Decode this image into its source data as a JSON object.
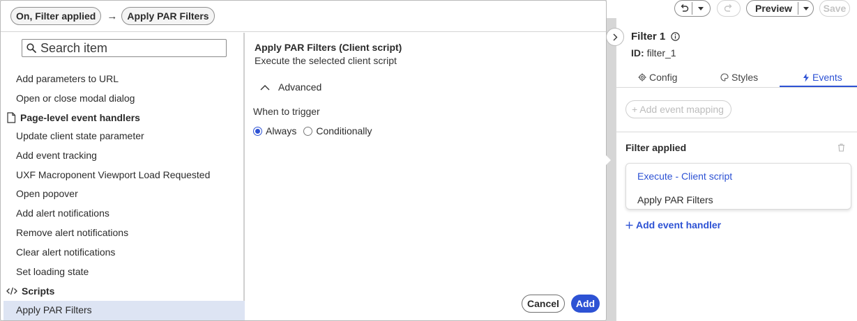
{
  "modal": {
    "breadcrumb": {
      "event": "On, Filter applied",
      "arrow": "→",
      "action": "Apply PAR Filters"
    },
    "search": {
      "placeholder": "Search item"
    },
    "menu_items": [
      "Add parameters to URL",
      "Open or close modal dialog"
    ],
    "group_page_level": "Page-level event handlers",
    "page_level_items": [
      "Update client state parameter",
      "Add event tracking",
      "UXF Macroponent Viewport Load Requested",
      "Open popover",
      "Add alert notifications",
      "Remove alert notifications",
      "Clear alert notifications",
      "Set loading state"
    ],
    "group_scripts": "Scripts",
    "scripts_items": [
      "Apply PAR Filters"
    ],
    "detail": {
      "title": "Apply PAR Filters (Client script)",
      "subtitle": "Execute the selected client script",
      "advanced_label": "Advanced",
      "trigger_label": "When to trigger",
      "radio_always": "Always",
      "radio_conditionally": "Conditionally",
      "selected_trigger": "Always"
    },
    "cancel_label": "Cancel",
    "add_label": "Add"
  },
  "toolbar": {
    "preview_label": "Preview",
    "save_label": "Save"
  },
  "panel": {
    "title": "Filter 1",
    "id_label": "ID:",
    "id_value": "filter_1",
    "tabs": [
      {
        "label": "Config",
        "icon": "gear-icon"
      },
      {
        "label": "Styles",
        "icon": "palette-icon"
      },
      {
        "label": "Events",
        "icon": "lightning-icon",
        "active": true
      }
    ],
    "add_event_mapping": "+ Add event mapping",
    "event_name": "Filter applied",
    "handler_type": "Execute - Client script",
    "handler_name": "Apply PAR Filters",
    "add_event_handler": "Add event handler"
  },
  "colors": {
    "accent": "#2d52d4",
    "selected_row": "#dde4f3",
    "disabled": "#c4c4c4"
  }
}
